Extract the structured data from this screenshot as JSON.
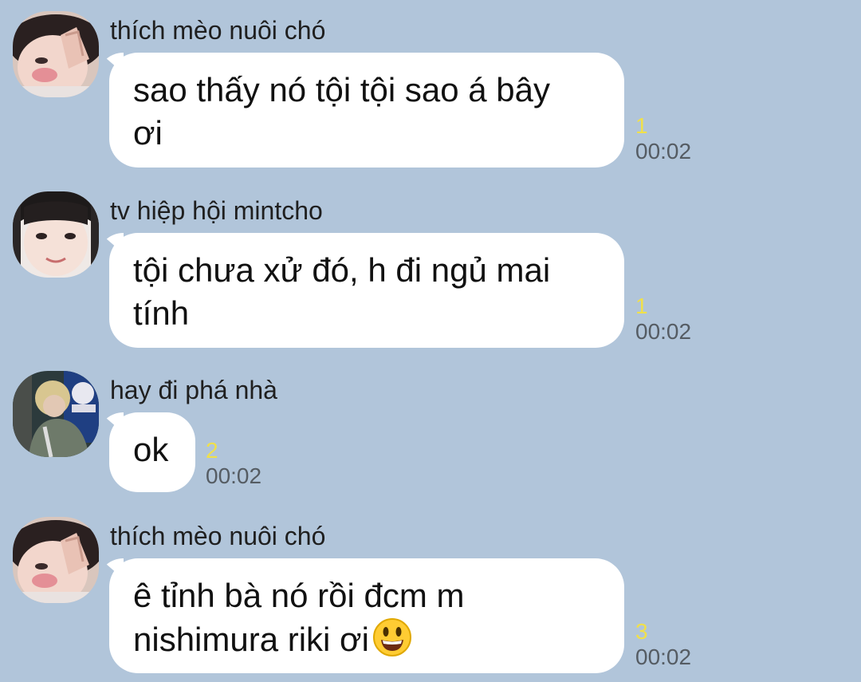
{
  "colors": {
    "background": "#b1c5da",
    "bubble": "#ffffff",
    "unread": "#f0e04a",
    "time": "#555c63"
  },
  "messages": [
    {
      "sender": "thích mèo nuôi chó",
      "lines": [
        "sao thấy nó tội tội sao á bây",
        "ơi"
      ],
      "unread": "1",
      "time": "00:02",
      "avatar": "avatar-peace-sign"
    },
    {
      "sender": "tv hiệp hội mintcho",
      "lines": [
        "tội chưa xử đó, h đi ngủ mai",
        "tính"
      ],
      "unread": "1",
      "time": "00:02",
      "avatar": "avatar-smiling-face"
    },
    {
      "sender": "hay đi phá nhà",
      "lines": [
        "ok"
      ],
      "unread": "2",
      "time": "00:02",
      "avatar": "avatar-blond-person"
    },
    {
      "sender": "thích mèo nuôi chó",
      "lines": [
        "ê tỉnh bà nó rồi đcm m",
        "nishimura riki ơi"
      ],
      "emoji": "grinning-face-emoji",
      "unread": "3",
      "time": "00:02",
      "avatar": "avatar-peace-sign"
    }
  ]
}
